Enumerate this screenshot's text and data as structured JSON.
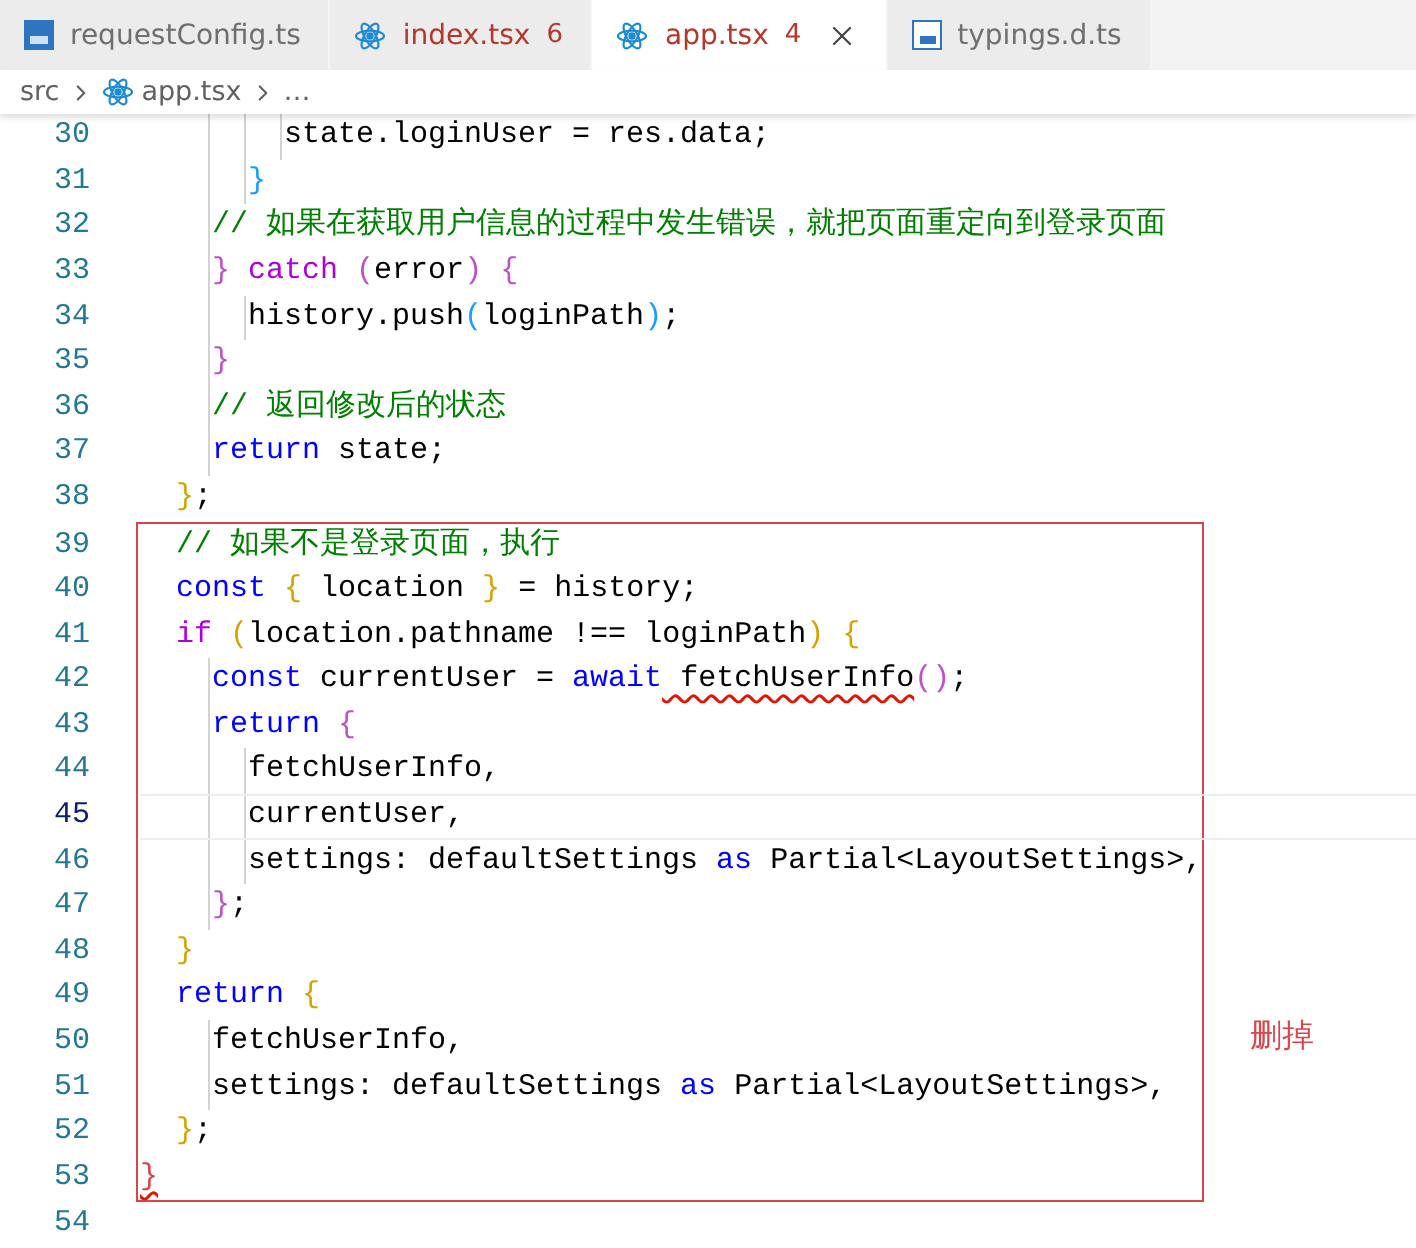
{
  "tabs": [
    {
      "label": "requestConfig.ts",
      "kind": "typescript",
      "errors": false,
      "selected": false
    },
    {
      "label": "index.tsx",
      "kind": "react",
      "badge": "6",
      "errors": true,
      "selected": false
    },
    {
      "label": "app.tsx",
      "kind": "react",
      "badge": "4",
      "errors": true,
      "selected": true
    },
    {
      "label": "typings.d.ts",
      "kind": "declaration",
      "errors": false,
      "selected": false
    }
  ],
  "breadcrumb": [
    {
      "label": "src",
      "kind": "folder"
    },
    {
      "label": "app.tsx",
      "kind": "react"
    },
    {
      "label": "…",
      "kind": "more"
    }
  ],
  "lines_before": [
    {
      "number": "30",
      "current": false,
      "tokens": [
        {
          "t": "        state.loginUser = res.data;",
          "kind": "plain"
        }
      ]
    },
    {
      "number": "31",
      "current": false,
      "tokens": [
        {
          "t": "      }",
          "kind": "bracket3"
        }
      ]
    },
    {
      "number": "32",
      "current": false,
      "tokens": [
        {
          "t": "    // 如果在获取用户信息的过程中发生错误，就把页面重定向到登录页面",
          "kind": "comment"
        }
      ]
    },
    {
      "number": "33",
      "current": false,
      "tokens": [
        {
          "t": "    }",
          "kind": "bracket2"
        },
        {
          "t": " catch",
          "kind": "control"
        },
        {
          "t": " (",
          "kind": "bracket2"
        },
        {
          "t": "error",
          "kind": "plain"
        },
        {
          "t": ")",
          "kind": "bracket2"
        },
        {
          "t": " {",
          "kind": "bracket2"
        }
      ]
    },
    {
      "number": "34",
      "current": false,
      "tokens": [
        {
          "t": "      history.push",
          "kind": "plain"
        },
        {
          "t": "(",
          "kind": "bracket3"
        },
        {
          "t": "loginPath",
          "kind": "plain"
        },
        {
          "t": ")",
          "kind": "bracket3"
        },
        {
          "t": ";",
          "kind": "plain"
        }
      ]
    },
    {
      "number": "35",
      "current": false,
      "tokens": [
        {
          "t": "    }",
          "kind": "bracket2"
        }
      ]
    },
    {
      "number": "36",
      "current": false,
      "tokens": [
        {
          "t": "    // 返回修改后的状态",
          "kind": "comment"
        }
      ]
    },
    {
      "number": "37",
      "current": false,
      "tokens": [
        {
          "t": "    return",
          "kind": "keyword"
        },
        {
          "t": " state;",
          "kind": "plain"
        }
      ]
    },
    {
      "number": "38",
      "current": false,
      "tokens": [
        {
          "t": "  }",
          "kind": "bracket1"
        },
        {
          "t": ";",
          "kind": "plain"
        }
      ]
    }
  ],
  "marked_block": {
    "note": "删掉",
    "lines": [
      {
        "number": "39",
        "current": false,
        "tokens": [
          {
            "t": "  // 如果不是登录页面，执行",
            "kind": "comment"
          }
        ]
      },
      {
        "number": "40",
        "current": false,
        "tokens": [
          {
            "t": "  const",
            "kind": "keyword"
          },
          {
            "t": " {",
            "kind": "bracket1"
          },
          {
            "t": " location ",
            "kind": "plain"
          },
          {
            "t": "}",
            "kind": "bracket1"
          },
          {
            "t": " = history;",
            "kind": "plain"
          }
        ]
      },
      {
        "number": "41",
        "current": false,
        "tokens": [
          {
            "t": "  if",
            "kind": "control"
          },
          {
            "t": " (",
            "kind": "bracket1"
          },
          {
            "t": "location.pathname !== loginPath",
            "kind": "plain"
          },
          {
            "t": ")",
            "kind": "bracket1"
          },
          {
            "t": " {",
            "kind": "bracket1"
          }
        ]
      },
      {
        "number": "42",
        "current": false,
        "tokens": [
          {
            "t": "    const",
            "kind": "keyword"
          },
          {
            "t": " currentUser = ",
            "kind": "plain"
          },
          {
            "t": "await",
            "kind": "keyword"
          },
          {
            "t": " fetchUserInfo",
            "kind": "error"
          },
          {
            "t": "()",
            "kind": "bracket2"
          },
          {
            "t": ";",
            "kind": "plain"
          }
        ]
      },
      {
        "number": "43",
        "current": false,
        "tokens": [
          {
            "t": "    return",
            "kind": "keyword"
          },
          {
            "t": " {",
            "kind": "bracket2"
          }
        ]
      },
      {
        "number": "44",
        "current": false,
        "tokens": [
          {
            "t": "      fetchUserInfo,",
            "kind": "plain"
          }
        ]
      },
      {
        "number": "45",
        "current": true,
        "tokens": [
          {
            "t": "      currentUser,",
            "kind": "plain"
          }
        ]
      },
      {
        "number": "46",
        "current": false,
        "tokens": [
          {
            "t": "      settings: defaultSettings ",
            "kind": "plain"
          },
          {
            "t": "as",
            "kind": "keyword"
          },
          {
            "t": " Partial<LayoutSettings>,",
            "kind": "plain"
          }
        ]
      },
      {
        "number": "47",
        "current": false,
        "tokens": [
          {
            "t": "    }",
            "kind": "bracket2"
          },
          {
            "t": ";",
            "kind": "plain"
          }
        ]
      },
      {
        "number": "48",
        "current": false,
        "tokens": [
          {
            "t": "  }",
            "kind": "bracket1"
          }
        ]
      },
      {
        "number": "49",
        "current": false,
        "tokens": [
          {
            "t": "  return",
            "kind": "keyword"
          },
          {
            "t": " {",
            "kind": "bracket1"
          }
        ]
      },
      {
        "number": "50",
        "current": false,
        "tokens": [
          {
            "t": "    fetchUserInfo,",
            "kind": "plain"
          }
        ]
      },
      {
        "number": "51",
        "current": false,
        "tokens": [
          {
            "t": "    settings: defaultSettings ",
            "kind": "plain"
          },
          {
            "t": "as",
            "kind": "keyword"
          },
          {
            "t": " Partial<LayoutSettings>,",
            "kind": "plain"
          }
        ]
      },
      {
        "number": "52",
        "current": false,
        "tokens": [
          {
            "t": "  }",
            "kind": "bracket1"
          },
          {
            "t": ";",
            "kind": "plain"
          }
        ]
      },
      {
        "number": "53",
        "current": false,
        "tokens": [
          {
            "t": "}",
            "kind": "bracket-error"
          }
        ]
      }
    ]
  },
  "lines_after": [
    {
      "number": "54",
      "current": false
    }
  ]
}
